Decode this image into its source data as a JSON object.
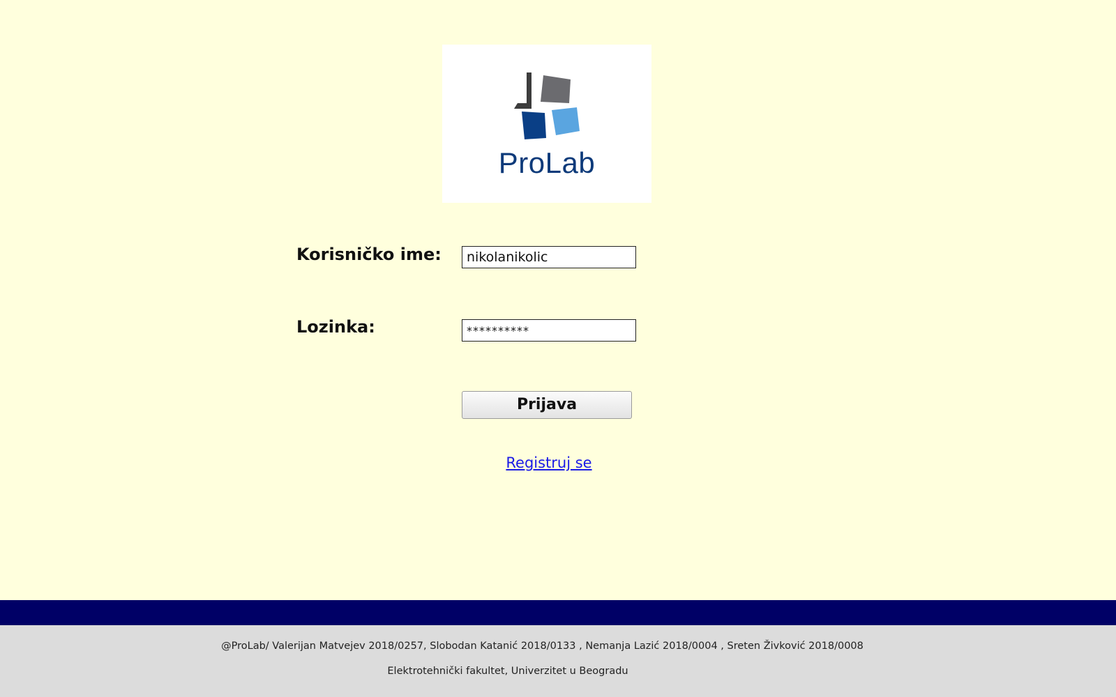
{
  "logo": {
    "text": "ProLab",
    "icon": "prolab-logo-icon",
    "colors": {
      "dark_gray": "#3d3d3d",
      "gray": "#6b6b6f",
      "dark_blue": "#0a3f86",
      "light_blue": "#5aa5e0",
      "text": "#0d3a7a"
    }
  },
  "login_form": {
    "username_label": "Korisničko ime:",
    "username_value": "nikolanikolic",
    "password_label": "Lozinka:",
    "password_value": "**********",
    "submit_label": "Prijava",
    "register_link": "Registruj se"
  },
  "footer": {
    "credits": "@ProLab/ Valerijan Matvejev 2018/0257, Slobodan Katanić 2018/0133 , Nemanja Lazić 2018/0004 , Sreten Živković 2018/0008",
    "institution": "Elektrotehnički fakultet, Univerzitet u Beogradu"
  },
  "colors": {
    "page_background": "#ffffdd",
    "footer_bar": "#000066",
    "footer_background": "#dcdcdc",
    "link": "#1a1ae6"
  }
}
